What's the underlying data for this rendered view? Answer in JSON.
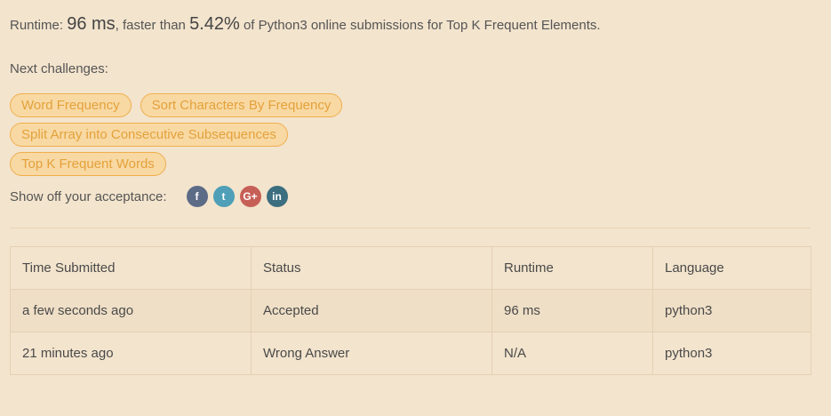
{
  "result": {
    "prefix": "Runtime: ",
    "runtime_value": "96 ms",
    "middle": ", faster than ",
    "percent": "5.42%",
    "suffix": " of Python3 online submissions for Top K Frequent Elements."
  },
  "next": {
    "label": "Next challenges:",
    "challenges": [
      "Word Frequency",
      "Sort Characters By Frequency",
      "Split Array into Consecutive Subsequences",
      "Top K Frequent Words"
    ]
  },
  "share": {
    "label": "Show off your acceptance:",
    "icons": [
      "facebook-icon",
      "twitter-icon",
      "google-plus-icon",
      "linkedin-icon"
    ],
    "glyphs": [
      "f",
      "t",
      "G+",
      "in"
    ]
  },
  "table": {
    "headers": [
      "Time Submitted",
      "Status",
      "Runtime",
      "Language"
    ],
    "rows": [
      {
        "time": "a few seconds ago",
        "status": "Accepted",
        "runtime": "96 ms",
        "language": "python3"
      },
      {
        "time": "21 minutes ago",
        "status": "Wrong Answer",
        "runtime": "N/A",
        "language": "python3"
      }
    ]
  },
  "colors": {
    "background": "#f3e4cd",
    "chip_text": "#e4a13b",
    "accepted": "#3c8a5e",
    "wrong_answer": "#a3433b"
  }
}
